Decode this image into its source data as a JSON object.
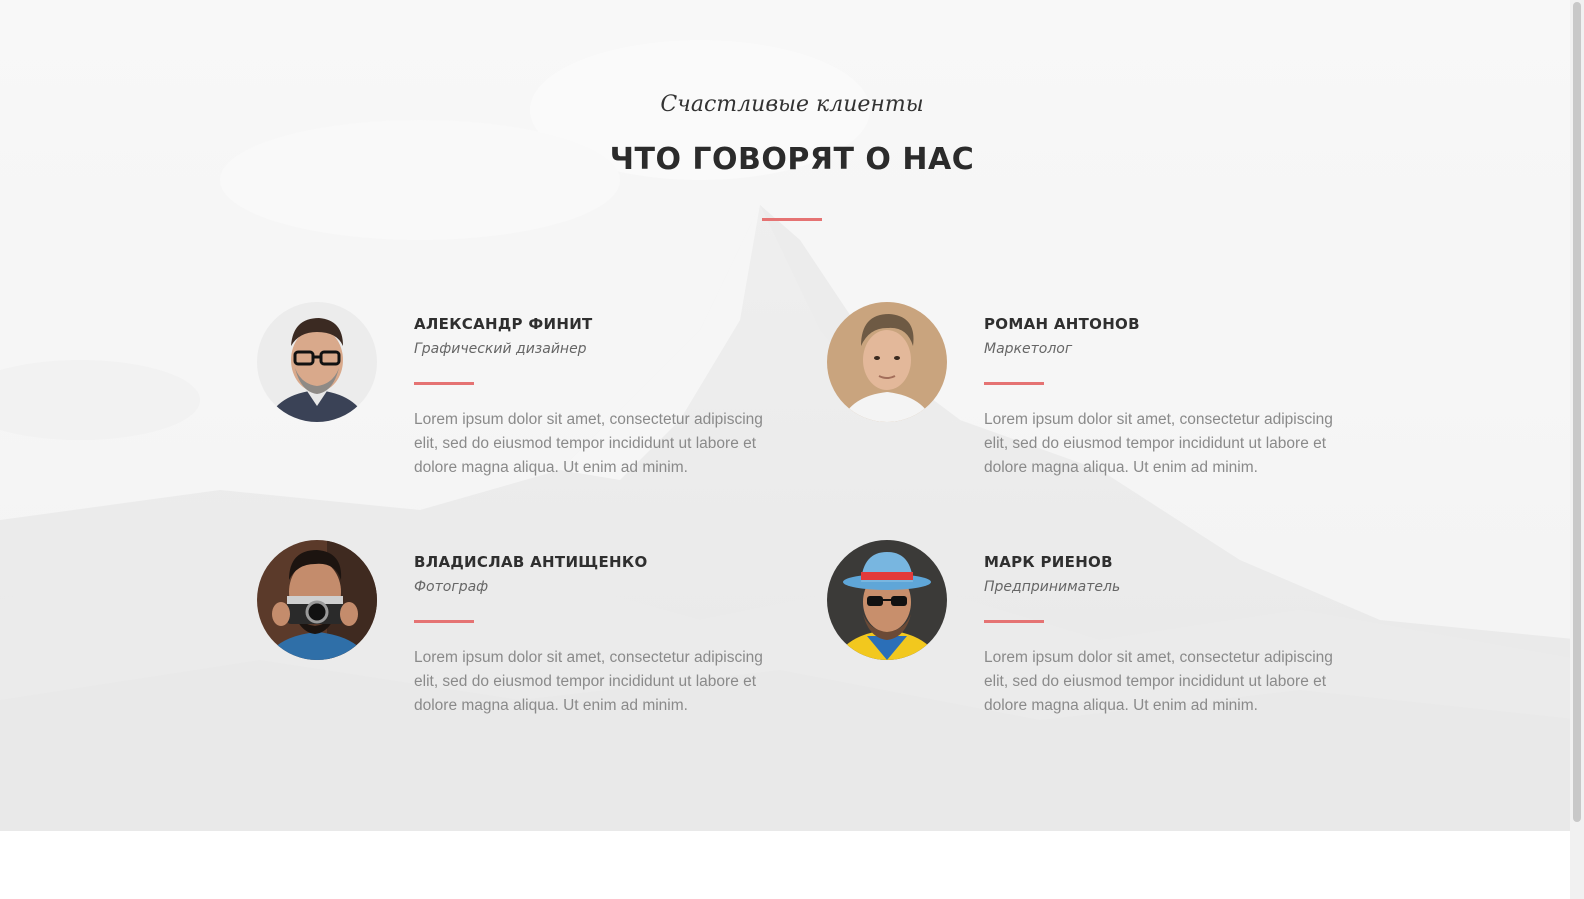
{
  "section": {
    "eyebrow": "Счастливые клиенты",
    "title": "ЧТО ГОВОРЯТ О НАС"
  },
  "testimonials": [
    {
      "name": "АЛЕКСАНДР ФИНИТ",
      "role": "Графический дизайнер",
      "text": "Lorem ipsum dolor sit amet, consectetur adipiscing elit, sed do eiusmod tempor incididunt ut labore et dolore magna aliqua. Ut enim ad minim.",
      "avatar": "man-with-glasses-portrait"
    },
    {
      "name": "РОМАН АНТОНОВ",
      "role": "Маркетолог",
      "text": "Lorem ipsum dolor sit amet, consectetur adipiscing elit, sed do eiusmod tempor incididunt ut labore et dolore magna aliqua. Ut enim ad minim.",
      "avatar": "young-man-portrait"
    },
    {
      "name": "ВЛАДИСЛАВ АНТИЩЕНКО",
      "role": "Фотограф",
      "text": "Lorem ipsum dolor sit amet, consectetur adipiscing elit, sed do eiusmod tempor incididunt ut labore et dolore magna aliqua. Ut enim ad minim.",
      "avatar": "photographer-with-camera-portrait"
    },
    {
      "name": "МАРК РИЕНОВ",
      "role": "Предприниматель",
      "text": "Lorem ipsum dolor sit amet, consectetur adipiscing elit, sed do eiusmod tempor incididunt ut labore et dolore magna aliqua. Ut enim ad minim.",
      "avatar": "man-with-hat-portrait"
    }
  ],
  "colors": {
    "accent": "#e57373",
    "heading": "#2b2b2b",
    "body_text": "#8a8a8a"
  }
}
